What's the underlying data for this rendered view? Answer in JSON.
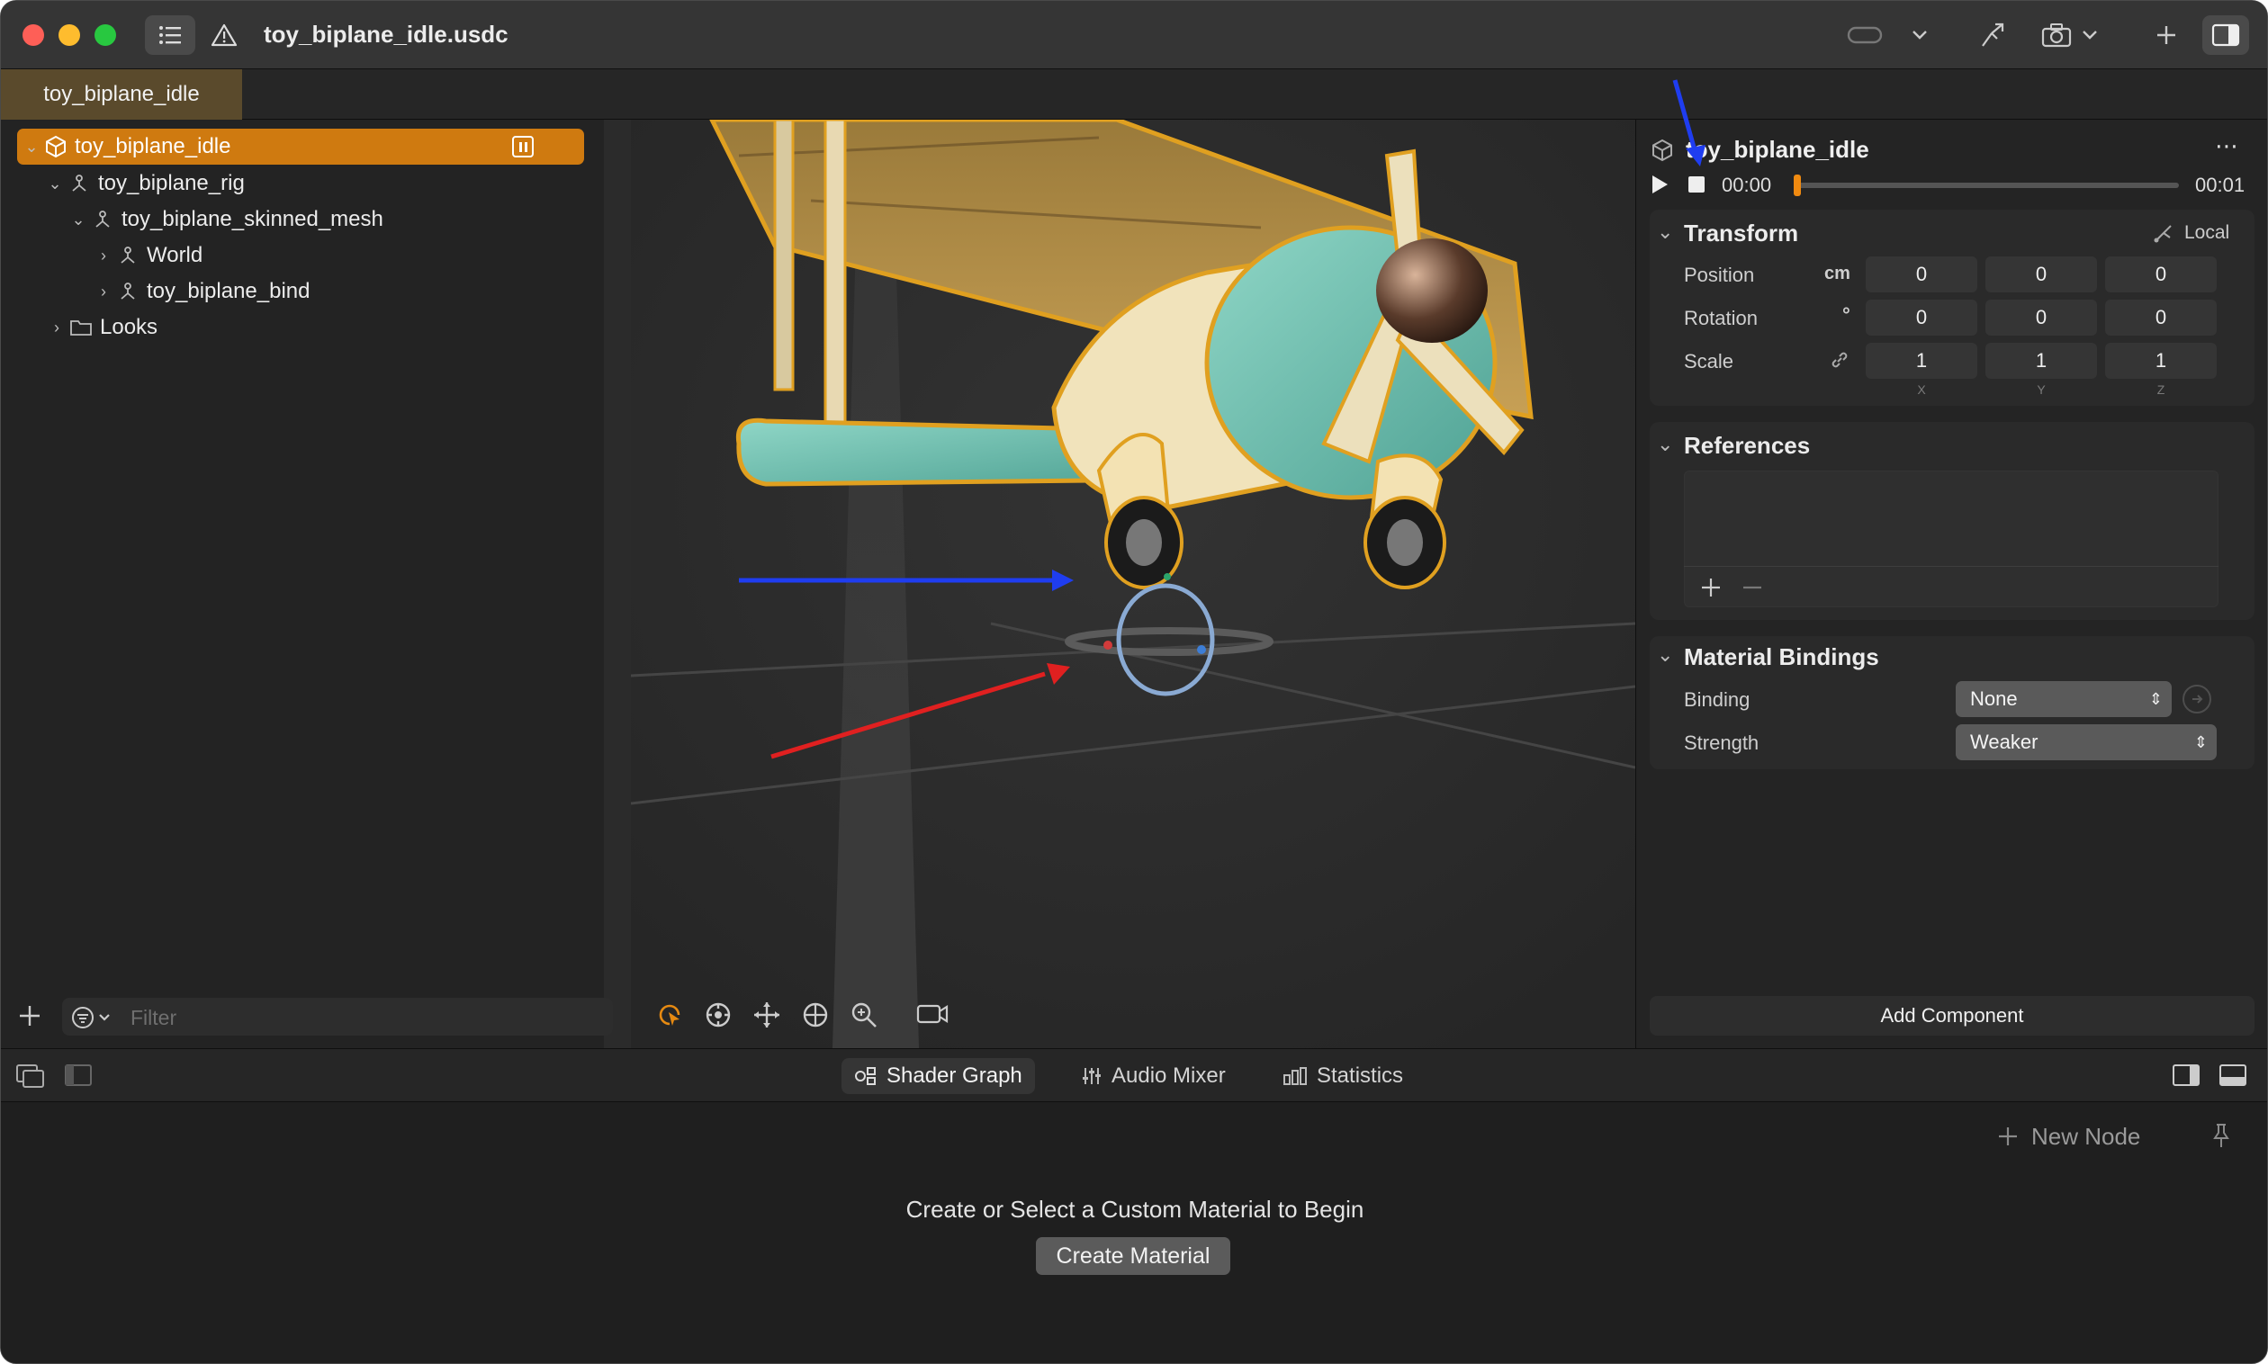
{
  "window": {
    "title": "toy_biplane_idle.usdc"
  },
  "document_tab": {
    "label": "toy_biplane_idle"
  },
  "navigator": {
    "root": "toy_biplane_idle",
    "items": [
      {
        "label": "toy_biplane_rig"
      },
      {
        "label": "toy_biplane_skinned_mesh"
      },
      {
        "label": "World"
      },
      {
        "label": "toy_biplane_bind"
      },
      {
        "label": "Looks"
      }
    ],
    "filter_placeholder": "Filter"
  },
  "inspector": {
    "entity_name": "toy_biplane_idle",
    "timeline": {
      "current": "00:00",
      "end": "00:01"
    },
    "transform": {
      "title": "Transform",
      "space": "Local",
      "position": {
        "label": "Position",
        "unit": "cm",
        "x": "0",
        "y": "0",
        "z": "0"
      },
      "rotation": {
        "label": "Rotation",
        "unit": "°",
        "x": "0",
        "y": "0",
        "z": "0"
      },
      "scale": {
        "label": "Scale",
        "x": "1",
        "y": "1",
        "z": "1"
      },
      "axes": [
        "X",
        "Y",
        "Z"
      ]
    },
    "references": {
      "title": "References"
    },
    "material_bindings": {
      "title": "Material Bindings",
      "binding_label": "Binding",
      "binding_value": "None",
      "strength_label": "Strength",
      "strength_value": "Weaker"
    },
    "add_component": "Add Component"
  },
  "bottom_panel": {
    "tabs": [
      {
        "label": "Shader Graph",
        "active": true
      },
      {
        "label": "Audio Mixer"
      },
      {
        "label": "Statistics"
      }
    ],
    "new_node": "New Node",
    "empty_message": "Create or Select a Custom Material to Begin",
    "create_button": "Create Material"
  },
  "colors": {
    "accent": "#cf7a10",
    "selection_outline": "#e0a020",
    "annotation_blue": "#1f3df0",
    "annotation_red": "#e02020"
  }
}
